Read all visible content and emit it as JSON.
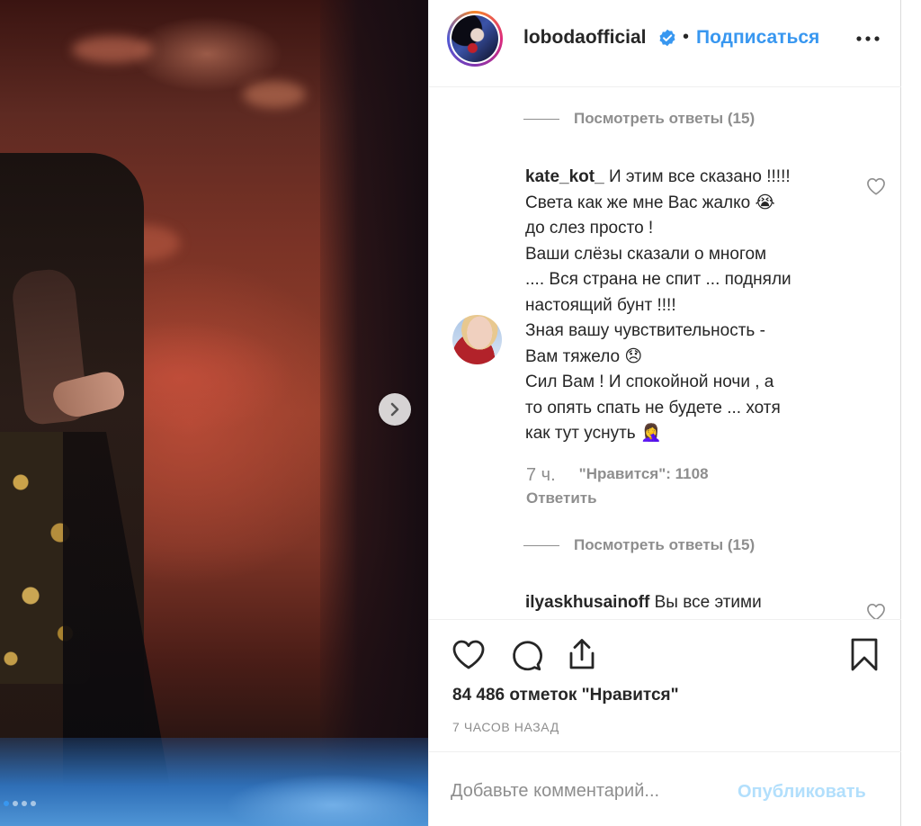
{
  "post": {
    "username": "lobodaofficial",
    "verified_icon": "verified-badge-icon",
    "separator": "•",
    "follow_label": "Подписаться",
    "more_icon": "more-horizontal-icon"
  },
  "comments": {
    "view_replies_1": "Посмотреть ответы (15)",
    "view_replies_2": "Посмотреть ответы (15)",
    "items": [
      {
        "username": "kate_kot_",
        "lines": [
          "И этим все сказано !!!!!",
          "Света как же мне Вас жалко 😭",
          "до слез просто !",
          "Ваши слёзы сказали о многом",
          ".... Вся страна не спит ... подняли",
          "настоящий бунт !!!!",
          "Зная вашу чувствительность -",
          "Вам тяжело 😞",
          "Сил Вам ! И спокойной ночи , а",
          "то опять спать не будете ... хотя",
          "как тут уснуть 🤦‍♀️"
        ],
        "time": "7 ч.",
        "likes": "\"Нравится\": 1108",
        "reply_label": "Ответить"
      },
      {
        "username": "ilyaskhusainoff",
        "text": "Вы все этими"
      }
    ]
  },
  "actions": {
    "like_icon": "heart-icon",
    "comment_icon": "comment-icon",
    "share_icon": "share-icon",
    "save_icon": "bookmark-icon"
  },
  "likes_text": "84 486 отметок \"Нравится\"",
  "time_ago": "7 ЧАСОВ НАЗАД",
  "comment_box": {
    "placeholder": "Добавьте комментарий...",
    "post_label": "Опубликовать"
  },
  "colors": {
    "accent": "#3897f0",
    "muted": "#8e8e8e",
    "post_disabled": "#b2dffc"
  }
}
